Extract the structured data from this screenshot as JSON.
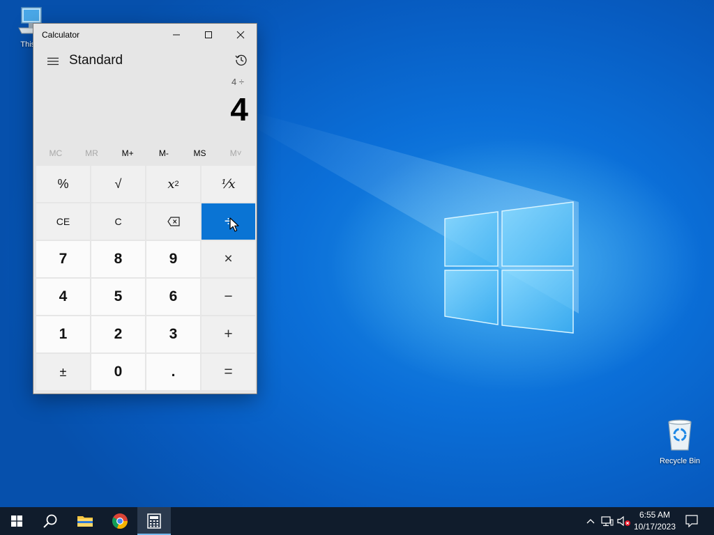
{
  "desktop": {
    "icons": [
      {
        "label": "This P"
      },
      {
        "label": "Recycle Bin"
      }
    ]
  },
  "window": {
    "title": "Calculator",
    "mode": "Standard"
  },
  "display": {
    "expression": "4 ÷",
    "result": "4"
  },
  "memory": [
    {
      "label": "MC",
      "enabled": false
    },
    {
      "label": "MR",
      "enabled": false
    },
    {
      "label": "M+",
      "enabled": true
    },
    {
      "label": "M-",
      "enabled": true
    },
    {
      "label": "MS",
      "enabled": true
    },
    {
      "label": "M˅",
      "enabled": false
    }
  ],
  "keys": {
    "percent": "%",
    "sqrt": "√",
    "square_base": "x",
    "square_exp": "2",
    "reciprocal": "⅟x",
    "clear_entry": "CE",
    "clear": "C",
    "divide": "÷",
    "seven": "7",
    "eight": "8",
    "nine": "9",
    "multiply": "×",
    "four": "4",
    "five": "5",
    "six": "6",
    "subtract": "−",
    "one": "1",
    "two": "2",
    "three": "3",
    "add": "+",
    "negate": "±",
    "zero": "0",
    "decimal": ".",
    "equals": "="
  },
  "colors": {
    "accent": "#0a74d4",
    "taskbar": "#101c2c"
  },
  "taskbar": {
    "time": "6:55 AM",
    "date": "10/17/2023"
  }
}
